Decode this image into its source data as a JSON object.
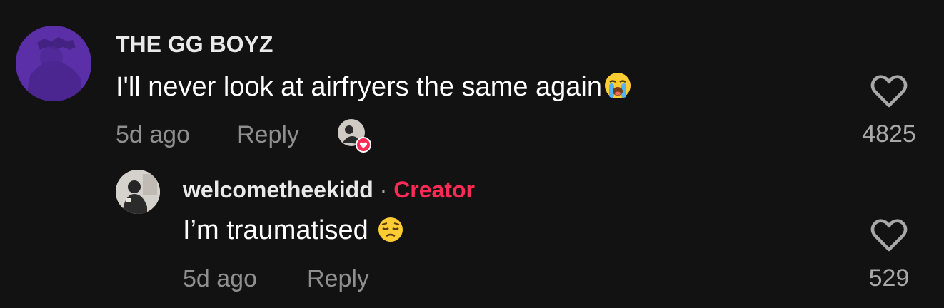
{
  "comment": {
    "username": "THE GG BOYZ",
    "text": "I'll never look at airfryers the same again",
    "text_emoji": "loudly-crying-face-emoji",
    "time": "5d ago",
    "reply_label": "Reply",
    "like_count": "4825",
    "liked_by_creator": true
  },
  "reply": {
    "username": "welcometheekidd",
    "separator": "·",
    "badge": "Creator",
    "text": "I’m traumatised",
    "text_emoji": "pensive-face-emoji",
    "time": "5d ago",
    "reply_label": "Reply",
    "like_count": "529"
  },
  "colors": {
    "background": "#121212",
    "creator_badge": "#fe2c55",
    "muted_text": "#8f8f8f",
    "heart_badge": "#fe2c55"
  }
}
